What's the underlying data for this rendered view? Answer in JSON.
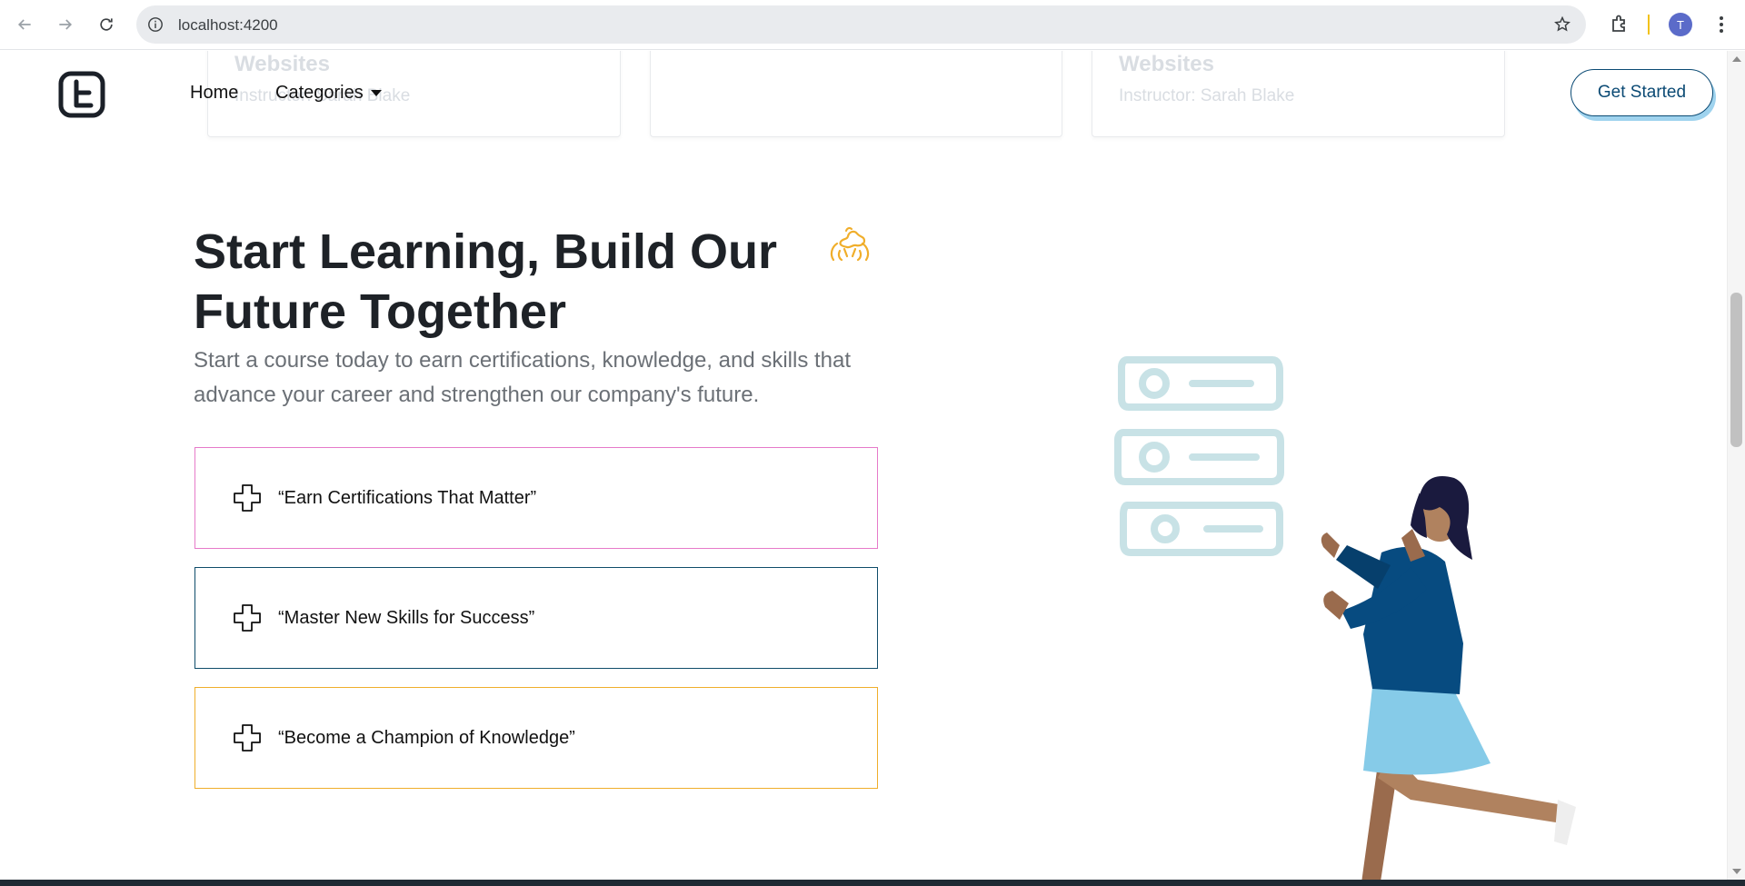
{
  "browser": {
    "url": "localhost:4200",
    "profile_initial": "T",
    "icons": [
      "back-arrow-icon",
      "forward-arrow-icon",
      "reload-icon",
      "info-icon",
      "bookmark-star-icon",
      "extensions-icon",
      "kebab-menu-icon"
    ]
  },
  "cards": [
    {
      "title": "Websites",
      "instructor": "Instructor: Sarah Blake"
    },
    {
      "title": "",
      "instructor": ""
    },
    {
      "title": "Websites",
      "instructor": "Instructor: Sarah Blake"
    }
  ],
  "header": {
    "nav": {
      "home": "Home",
      "categories": "Categories"
    },
    "cta": "Get Started",
    "colors": {
      "cta_border": "#0b4a74",
      "cta_shadow": "#9fd3ee"
    }
  },
  "hero": {
    "title": "Start Learning, Build Our Future Together",
    "subtitle": "Start a course today to earn certifications, knowledge, and skills that advance your career and strengthen our company's future.",
    "features": [
      {
        "label": "“Earn Certifications That Matter”",
        "border_color": "#e67ac9"
      },
      {
        "label": "“Master New Skills for Success”",
        "border_color": "#0f4d6a"
      },
      {
        "label": "“Become a Champion of Knowledge”",
        "border_color": "#f0ae2b"
      }
    ],
    "accent_color": "#f0ae2b"
  }
}
